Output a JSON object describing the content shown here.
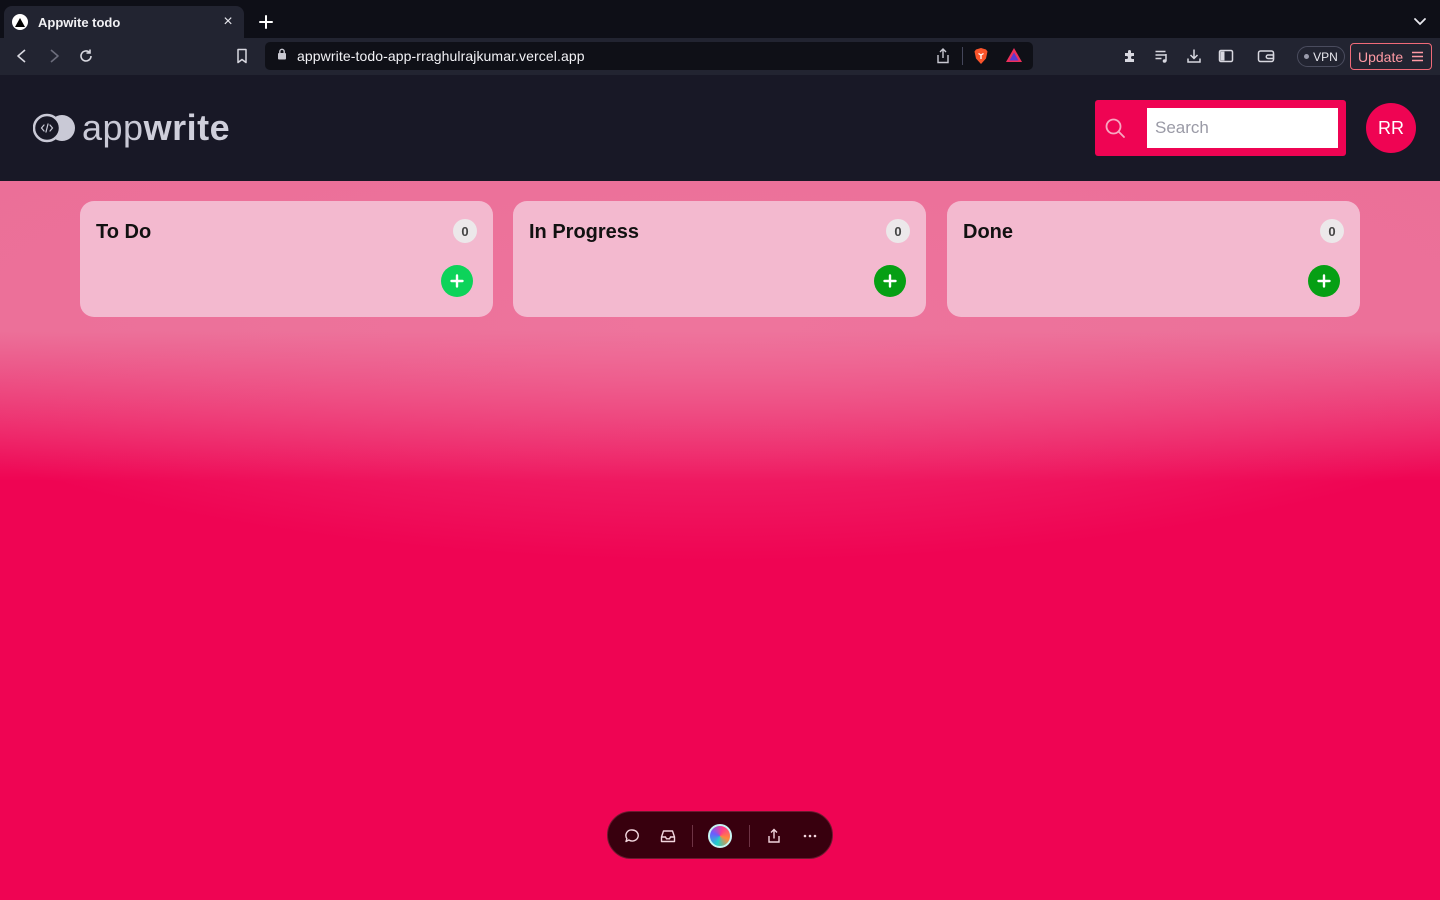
{
  "browser": {
    "tab": {
      "title": "Appwite todo",
      "close_label": "×"
    },
    "new_tab_label": "+",
    "address_bar": {
      "url": "appwrite-todo-app-rraghulrajkumar.vercel.app"
    },
    "vpn_label": "VPN",
    "update_label": "Update"
  },
  "header": {
    "logo": {
      "prefix": "app",
      "suffix": "write"
    },
    "search": {
      "placeholder": "Search",
      "value": ""
    },
    "avatar_initials": "RR"
  },
  "board": {
    "columns": [
      {
        "title": "To Do",
        "count": "0",
        "add_button_color": "#0dd35a"
      },
      {
        "title": "In Progress",
        "count": "0",
        "add_button_color": "#069f14"
      },
      {
        "title": "Done",
        "count": "0",
        "add_button_color": "#069f14"
      }
    ]
  },
  "theme": {
    "accent": "#ef0453",
    "header_bg": "#181826",
    "column_bg": "#f3b9cf"
  }
}
